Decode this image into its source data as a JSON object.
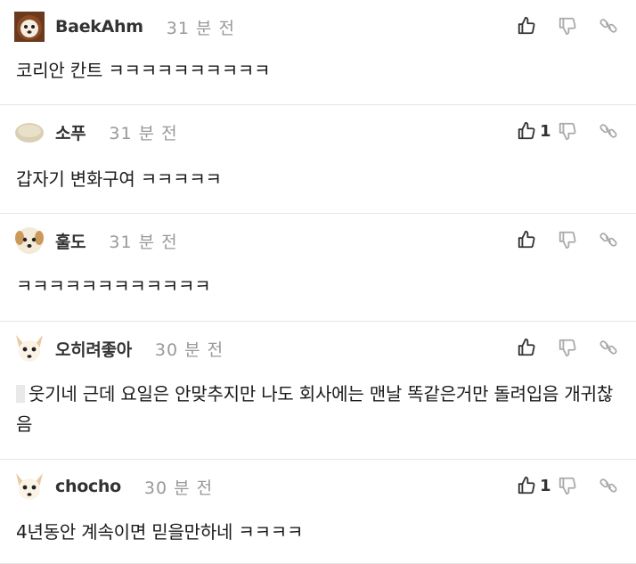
{
  "comments": [
    {
      "username": "BaekAhm",
      "time": "31 분 전",
      "text": "코리안 칸트 ㅋㅋㅋㅋㅋㅋㅋㅋㅋㅋ",
      "likes": "",
      "avatar": "lion-avatar-icon"
    },
    {
      "username": "소푸",
      "time": "31 분 전",
      "text": "갑자기 변화구여 ㅋㅋㅋㅋㅋ",
      "likes": "1",
      "avatar": "bun-avatar-icon"
    },
    {
      "username": "훌도",
      "time": "31 분 전",
      "text": "ㅋㅋㅋㅋㅋㅋㅋㅋㅋㅋㅋㅋ",
      "likes": "",
      "avatar": "dog-avatar-icon"
    },
    {
      "username": "오히려좋아",
      "time": "30 분 전",
      "text": "웃기네 근데 요일은 안맞추지만 나도 회사에는 맨날 똑같은거만 돌려입음 개귀찮음",
      "likes": "",
      "avatar": "chihuahua-avatar-icon"
    },
    {
      "username": "chocho",
      "time": "30 분 전",
      "text": "4년동안 계속이면 믿을만하네 ㅋㅋㅋㅋ",
      "likes": "1",
      "avatar": "chihuahua-avatar-icon"
    }
  ],
  "icons": {
    "like": "thumbs-up-icon",
    "dislike": "thumbs-down-icon",
    "link": "link-icon"
  }
}
